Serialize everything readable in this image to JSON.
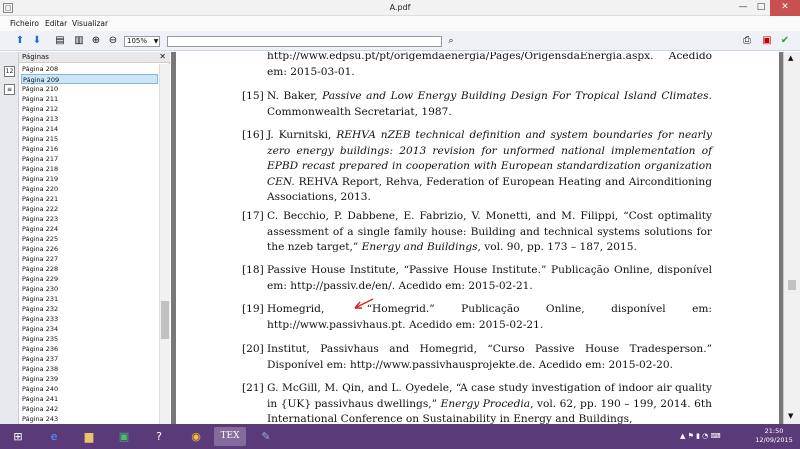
{
  "window": {
    "title": "A.pdf",
    "minimize": "—",
    "maximize": "□",
    "close": "✕"
  },
  "menu": [
    "Ficheiro",
    "Editar",
    "Visualizar"
  ],
  "toolbar": {
    "zoom": "105%",
    "search_placeholder": ""
  },
  "sidebar": {
    "title": "Páginas",
    "close": "✕",
    "selected_index": 1,
    "pages": [
      "Página 208",
      "Página 209",
      "Página 210",
      "Página 211",
      "Página 212",
      "Página 213",
      "Página 214",
      "Página 215",
      "Página 216",
      "Página 217",
      "Página 218",
      "Página 219",
      "Página 220",
      "Página 221",
      "Página 222",
      "Página 223",
      "Página 224",
      "Página 225",
      "Página 226",
      "Página 227",
      "Página 228",
      "Página 229",
      "Página 230",
      "Página 231",
      "Página 232",
      "Página 233",
      "Página 234",
      "Página 235",
      "Página 236",
      "Página 237",
      "Página 238",
      "Página 239",
      "Página 240",
      "Página 241",
      "Página 242",
      "Página 243"
    ]
  },
  "document": {
    "references": [
      {
        "num": "",
        "text": "http://www.edpsu.pt/pt/origemdaenergia/Pages/OrigensdaEnergia.aspx. Acedido em: 2015-03-01."
      },
      {
        "num": "[15]",
        "html": "N. Baker, <i>Passive and Low Energy Building Design For Tropical Island Climates.</i> Commonwealth Secretariat, 1987."
      },
      {
        "num": "[16]",
        "html": "J. Kurnitski, <i>REHVA nZEB technical definition and system boundaries for nearly zero energy buildings: 2013 revision for unformed national implementation of EPBD recast prepared in cooperation with European standardization organization CEN.</i> REHVA Report, Rehva, Federation of European Heating and Airconditioning Associations, 2013."
      },
      {
        "num": "[17]",
        "html": "C. Becchio, P. Dabbene, E. Fabrizio, V. Monetti, and M. Filippi, “Cost optimality assessment of a single family house: Building and technical systems solutions for the nzeb target,” <i>Energy and Buildings</i>, vol. 90, pp. 173 – 187, 2015."
      },
      {
        "num": "[18]",
        "html": "Passive House Institute, “Passive House Institute.” Publicação Online, disponível em: http://passiv.de/en/. Acedido em: 2015-02-21."
      },
      {
        "num": "[19]",
        "html": "Homegrid, &nbsp;&nbsp;&nbsp;&nbsp;&nbsp;&nbsp;&nbsp;“Homegrid.” &nbsp;&nbsp;&nbsp;&nbsp;Publicação &nbsp;&nbsp;&nbsp;&nbsp;Online, &nbsp;&nbsp;&nbsp;&nbsp;disponível &nbsp;&nbsp;&nbsp;&nbsp;em: http://www.passivhaus.pt. Acedido em: 2015-02-21."
      },
      {
        "num": "[20]",
        "html": "Institut, Passivhaus and Homegrid, “Curso Passive House Tradesperson.” Disponível em: http://www.passivhausprojekte.de. Acedido em: 2015-02-20."
      },
      {
        "num": "[21]",
        "html": "G. McGill, M. Qin, and L. Oyedele, “A case study investigation of indoor air quality in {UK} passivhaus dwellings,” <i>Energy Procedia</i>, vol. 62, pp. 190 – 199, 2014. 6th International Conference on Sustainability in Energy and Buildings,"
      }
    ]
  },
  "taskbar": {
    "time": "21:50",
    "date": "12/09/2015"
  },
  "colors": {
    "taskbar": "#5b3a7a",
    "selection": "#cde6f7",
    "close": "#c75050"
  }
}
